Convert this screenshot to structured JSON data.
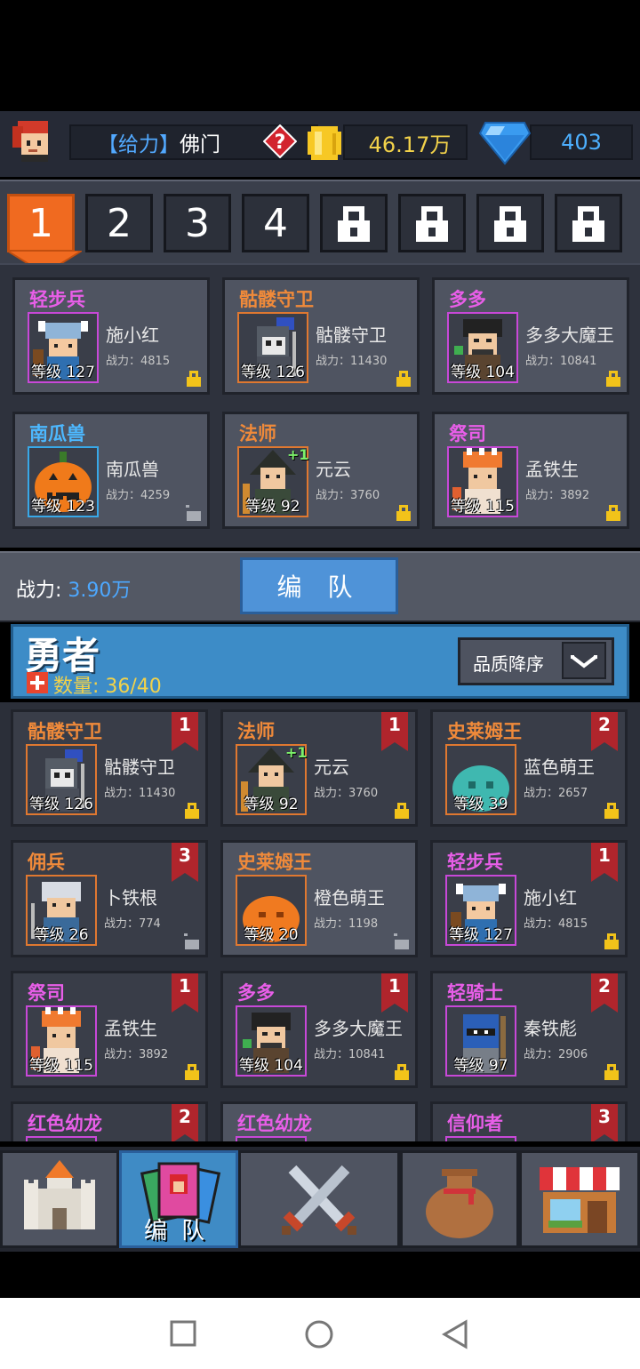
{
  "player": {
    "tag": "【给力】",
    "name": "佛门"
  },
  "currency": {
    "coins": "46.17万",
    "gems": "403"
  },
  "team_tabs": [
    {
      "label": "1",
      "state": "active"
    },
    {
      "label": "2",
      "state": "normal"
    },
    {
      "label": "3",
      "state": "normal"
    },
    {
      "label": "4",
      "state": "normal"
    },
    {
      "label": "",
      "state": "locked"
    },
    {
      "label": "",
      "state": "locked"
    },
    {
      "label": "",
      "state": "locked"
    },
    {
      "label": "",
      "state": "locked"
    }
  ],
  "squad": [
    {
      "cls": "轻步兵",
      "cls_color": "#e85ee8",
      "name": "施小红",
      "power": "战力：4815",
      "level": "等级 127",
      "frame": "#c848d8",
      "locked": true,
      "sprite": "viking"
    },
    {
      "cls": "骷髅守卫",
      "cls_color": "#f08a3a",
      "name": "骷髅守卫",
      "power": "战力：11430",
      "level": "等级 126",
      "frame": "#e07830",
      "locked": true,
      "sprite": "skeleton"
    },
    {
      "cls": "多多",
      "cls_color": "#e85ee8",
      "name": "多多大魔王",
      "power": "战力：10841",
      "level": "等级 104",
      "frame": "#c848d8",
      "locked": true,
      "sprite": "demon"
    },
    {
      "cls": "南瓜兽",
      "cls_color": "#4db8ff",
      "name": "南瓜兽",
      "power": "战力：4259",
      "level": "等级 123",
      "frame": "#38a8e8",
      "locked": false,
      "sprite": "pumpkin"
    },
    {
      "cls": "法师",
      "cls_color": "#f08a3a",
      "name": "元云",
      "power": "战力：3760",
      "level": "等级 92",
      "frame": "#e07830",
      "locked": true,
      "sprite": "mage",
      "badge": "+1"
    },
    {
      "cls": "祭司",
      "cls_color": "#e85ee8",
      "name": "孟铁生",
      "power": "战力：3892",
      "level": "等级 115",
      "frame": "#c848d8",
      "locked": true,
      "sprite": "priest"
    }
  ],
  "team_power": {
    "label": "战力:",
    "value": "3.90万"
  },
  "formation_button": "编 队",
  "heroes": {
    "title": "勇者",
    "count_label": "数量: 36/40",
    "sort_label": "品质降序"
  },
  "hero_list": [
    {
      "cls": "骷髅守卫",
      "cls_color": "#f08a3a",
      "name": "骷髅守卫",
      "power": "战力：11430",
      "level": "等级 126",
      "frame": "#e07830",
      "locked": true,
      "rank": "1",
      "dim": true,
      "sprite": "skeleton"
    },
    {
      "cls": "法师",
      "cls_color": "#f08a3a",
      "name": "元云",
      "power": "战力：3760",
      "level": "等级 92",
      "frame": "#e07830",
      "locked": true,
      "rank": "1",
      "dim": true,
      "sprite": "mage",
      "badge": "+1"
    },
    {
      "cls": "史莱姆王",
      "cls_color": "#f08a3a",
      "name": "蓝色萌王",
      "power": "战力：2657",
      "level": "等级 39",
      "frame": "#e07830",
      "locked": true,
      "rank": "2",
      "dim": true,
      "sprite": "slime-blue"
    },
    {
      "cls": "佣兵",
      "cls_color": "#f08a3a",
      "name": "卜铁根",
      "power": "战力：774",
      "level": "等级 26",
      "frame": "#e07830",
      "locked": false,
      "rank": "3",
      "dim": true,
      "sprite": "mercenary"
    },
    {
      "cls": "史莱姆王",
      "cls_color": "#f08a3a",
      "name": "橙色萌王",
      "power": "战力：1198",
      "level": "等级 20",
      "frame": "#e07830",
      "locked": false,
      "rank": "",
      "dim": false,
      "sprite": "slime-orange"
    },
    {
      "cls": "轻步兵",
      "cls_color": "#e85ee8",
      "name": "施小红",
      "power": "战力：4815",
      "level": "等级 127",
      "frame": "#c848d8",
      "locked": true,
      "rank": "1",
      "dim": true,
      "sprite": "viking"
    },
    {
      "cls": "祭司",
      "cls_color": "#e85ee8",
      "name": "孟铁生",
      "power": "战力：3892",
      "level": "等级 115",
      "frame": "#c848d8",
      "locked": true,
      "rank": "1",
      "dim": true,
      "sprite": "priest"
    },
    {
      "cls": "多多",
      "cls_color": "#e85ee8",
      "name": "多多大魔王",
      "power": "战力：10841",
      "level": "等级 104",
      "frame": "#c848d8",
      "locked": true,
      "rank": "1",
      "dim": true,
      "sprite": "demon"
    },
    {
      "cls": "轻骑士",
      "cls_color": "#e85ee8",
      "name": "秦铁彪",
      "power": "战力：2906",
      "level": "等级 97",
      "frame": "#c848d8",
      "locked": true,
      "rank": "2",
      "dim": true,
      "sprite": "knight"
    },
    {
      "cls": "红色幼龙",
      "cls_color": "#e85ee8",
      "name": "",
      "power": "",
      "level": "",
      "frame": "#c848d8",
      "locked": false,
      "rank": "2",
      "dim": true,
      "sprite": "none"
    },
    {
      "cls": "红色幼龙",
      "cls_color": "#e85ee8",
      "name": "",
      "power": "",
      "level": "",
      "frame": "#c848d8",
      "locked": false,
      "rank": "",
      "dim": false,
      "sprite": "none"
    },
    {
      "cls": "信仰者",
      "cls_color": "#e85ee8",
      "name": "",
      "power": "",
      "level": "",
      "frame": "#c848d8",
      "locked": false,
      "rank": "3",
      "dim": true,
      "sprite": "none"
    }
  ],
  "bottom_nav": [
    {
      "id": "castle",
      "icon": "castle-icon",
      "label": ""
    },
    {
      "id": "formation",
      "icon": "formation-cards-icon",
      "label": "编 队",
      "active": true
    },
    {
      "id": "battle",
      "icon": "crossed-swords-icon",
      "label": ""
    },
    {
      "id": "bag",
      "icon": "loot-bag-icon",
      "label": ""
    },
    {
      "id": "shop",
      "icon": "shop-icon",
      "label": ""
    }
  ],
  "colors": {
    "accent_orange": "#f06a20",
    "accent_blue": "#3d8cc7",
    "coin_yellow": "#f2d24a",
    "gem_blue": "#4db0ff"
  }
}
